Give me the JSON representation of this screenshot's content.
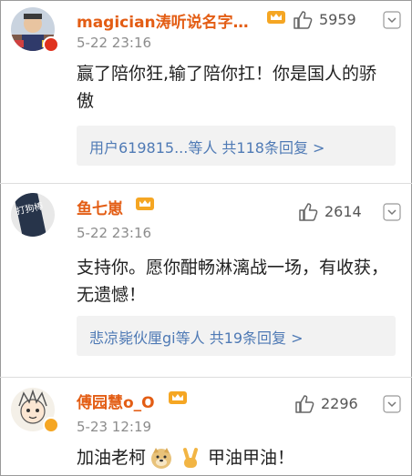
{
  "comments": [
    {
      "username": "magician涛听说名字…",
      "time": "5-22 23:16",
      "likes": "5959",
      "text": "赢了陪你狂,输了陪你扛！你是国人的骄傲",
      "replies": "用户619815...等人  共118条回复 >"
    },
    {
      "username": "鱼七崽",
      "time": "5-22 23:16",
      "likes": "2614",
      "text": "支持你。愿你酣畅淋漓战一场，有收获，无遗憾！",
      "replies": "悲凉毙伙厘gi等人  共19条回复 >"
    },
    {
      "username": "傅园慧o_O",
      "time": "5-23 12:19",
      "likes": "2296",
      "text_before": "加油老柯",
      "text_after": "甲油甲油！"
    }
  ],
  "avatar2_text": "打狗棒",
  "colors": {
    "username": "#e35d14",
    "reply_link": "#4f7ab5",
    "vip": "#f5a623",
    "verified": "#e0321e"
  },
  "icons": [
    "like-icon",
    "chevron-down-icon",
    "vip-crown-icon",
    "doge-emoji",
    "victory-hand-emoji"
  ]
}
